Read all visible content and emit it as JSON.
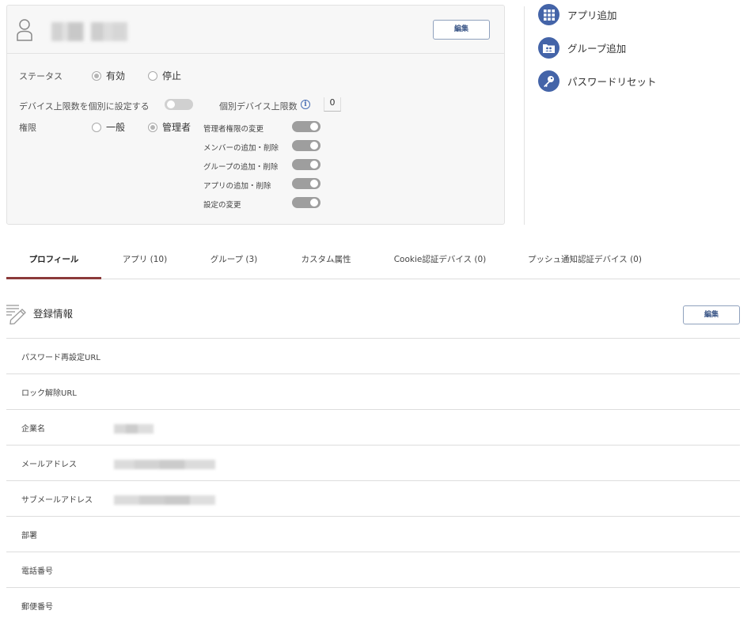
{
  "card": {
    "edit_label": "編集",
    "status_label": "ステータス",
    "status_options": [
      "有効",
      "停止"
    ],
    "device_limit_label": "デバイス上限数を個別に設定する",
    "individual_limit_label": "個別デバイス上限数",
    "individual_limit_value": "0",
    "role_label": "権限",
    "role_options": [
      "一般",
      "管理者"
    ],
    "permissions": [
      "管理者権限の変更",
      "メンバーの追加・削除",
      "グループの追加・削除",
      "アプリの追加・削除",
      "設定の変更"
    ]
  },
  "actions": [
    {
      "label": "アプリ追加",
      "icon": "grid-icon"
    },
    {
      "label": "グループ追加",
      "icon": "group-folder-icon"
    },
    {
      "label": "パスワードリセット",
      "icon": "key-icon"
    }
  ],
  "tabs": [
    "プロフィール",
    "アプリ (10)",
    "グループ (3)",
    "カスタム属性",
    "Cookie認証デバイス (0)",
    "プッシュ通知認証デバイス (0)"
  ],
  "section": {
    "title": "登録情報",
    "edit_label": "編集",
    "rows": [
      "パスワード再設定URL",
      "ロック解除URL",
      "企業名",
      "メールアドレス",
      "サブメールアドレス",
      "部署",
      "電話番号",
      "郵便番号"
    ]
  },
  "colors": {
    "accent": "#4464a8",
    "active_tab": "#8b3a3a"
  }
}
